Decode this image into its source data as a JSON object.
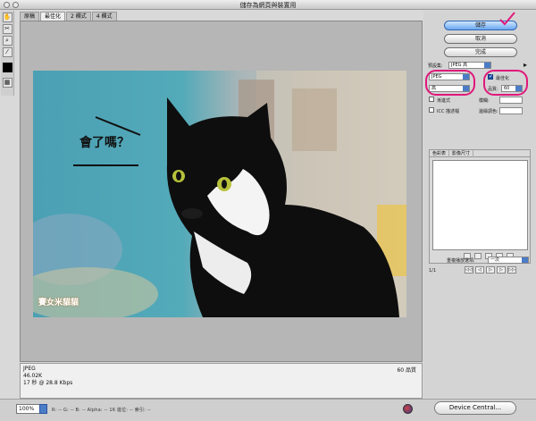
{
  "window": {
    "title": "儲存為網頁與裝置用"
  },
  "tabs": [
    {
      "label": "原稿",
      "active": false
    },
    {
      "label": "最佳化",
      "active": true
    },
    {
      "label": "2 欄式",
      "active": false
    },
    {
      "label": "4 欄式",
      "active": false
    }
  ],
  "image": {
    "caption": "會了嗎？",
    "watermark": "賽女米貓貓"
  },
  "info": {
    "format": "JPEG",
    "size": "46.02K",
    "speed": "17 秒 @ 28.8 Kbps",
    "quality_note": "60 品質"
  },
  "status": {
    "zoom": "100%",
    "readout": "R: --   G: --   B: --   Alpha: --   16 進位: --   索引: --",
    "device_central": "Device Central..."
  },
  "panel": {
    "save": "儲存",
    "cancel": "取消",
    "done": "完成",
    "preset_label": "預設集:",
    "preset_value": "JPEG 高",
    "format_value": "JPEG",
    "quality_level": "高",
    "optimize_label": "最佳化",
    "optimize_checked": true,
    "quality_label": "品質:",
    "quality_value": "60",
    "progressive_label": "漸進式",
    "blur_label": "模糊:",
    "icc_label": "ICC 描述檔",
    "matte_label": "邊緣調色:",
    "color_table_tab": "色彩表",
    "image_size_tab": "影像尺寸",
    "animation_label": "重複播放選項:",
    "animation_value": "一次",
    "frame_counter": "1/1"
  },
  "colors": {
    "accent": "#e0187a",
    "button_primary": "#6aa8f0"
  }
}
